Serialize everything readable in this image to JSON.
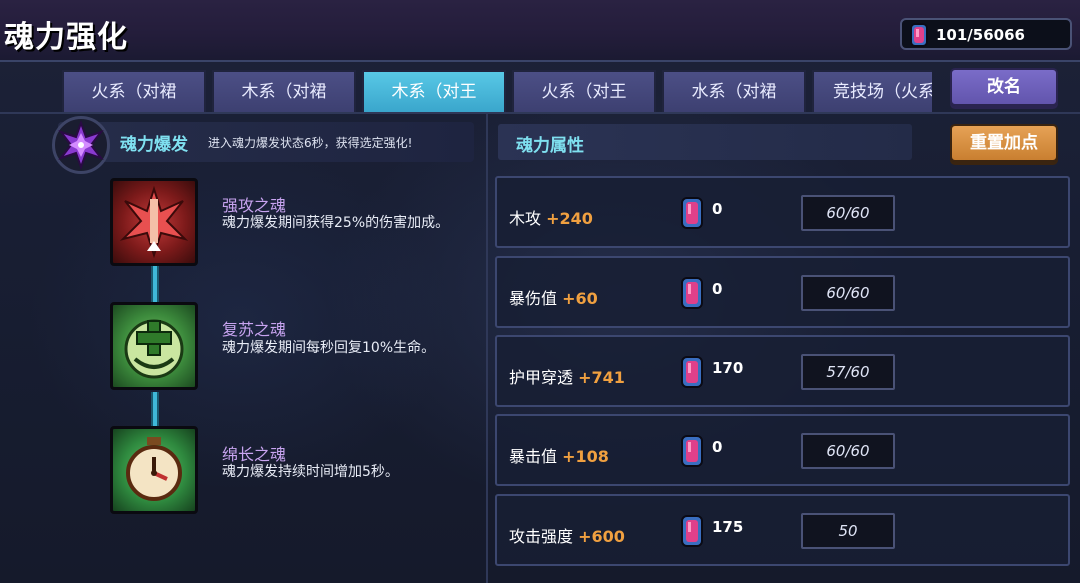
{
  "header": {
    "title": "魂力强化",
    "currency": {
      "icon": "soul-gem-icon",
      "value": "101/56066"
    }
  },
  "tabs": [
    {
      "label": "火系（对裙",
      "active": false
    },
    {
      "label": "木系（对裙",
      "active": false
    },
    {
      "label": "木系（对王",
      "active": true
    },
    {
      "label": "火系（对王",
      "active": false
    },
    {
      "label": "水系（对裙",
      "active": false
    },
    {
      "label": "竞技场（火系",
      "active": false
    }
  ],
  "buttons": {
    "rename": "改名",
    "reset": "重置加点"
  },
  "burst": {
    "title": "魂力爆发",
    "description": "进入魂力爆发状态6秒，获得选定强化!",
    "icon": "soul-burst-emblem-icon"
  },
  "skills": [
    {
      "name": "强攻之魂",
      "description": "魂力爆发期间获得25%的伤害加成。",
      "icon": "red-crossed-swords-icon"
    },
    {
      "name": "复苏之魂",
      "description": "魂力爆发期间每秒回复10%生命。",
      "icon": "green-healing-cross-icon"
    },
    {
      "name": "绵长之魂",
      "description": "魂力爆发持续时间增加5秒。",
      "icon": "green-clock-icon"
    }
  ],
  "attributes": {
    "title": "魂力属性",
    "rows": [
      {
        "name": "木攻",
        "bonus": "+240",
        "cost": "0",
        "progress": "60/60"
      },
      {
        "name": "暴伤值",
        "bonus": "+60",
        "cost": "0",
        "progress": "60/60"
      },
      {
        "name": "护甲穿透",
        "bonus": "+741",
        "cost": "170",
        "progress": "57/60"
      },
      {
        "name": "暴击值",
        "bonus": "+108",
        "cost": "0",
        "progress": "60/60"
      },
      {
        "name": "攻击强度",
        "bonus": "+600",
        "cost": "175",
        "progress": "50"
      }
    ]
  },
  "colors": {
    "accent_cyan": "#7fe0f0",
    "bonus_orange": "#f0a040",
    "active_tab": "#3aa6cc",
    "skill_name": "#c8a4f0"
  }
}
